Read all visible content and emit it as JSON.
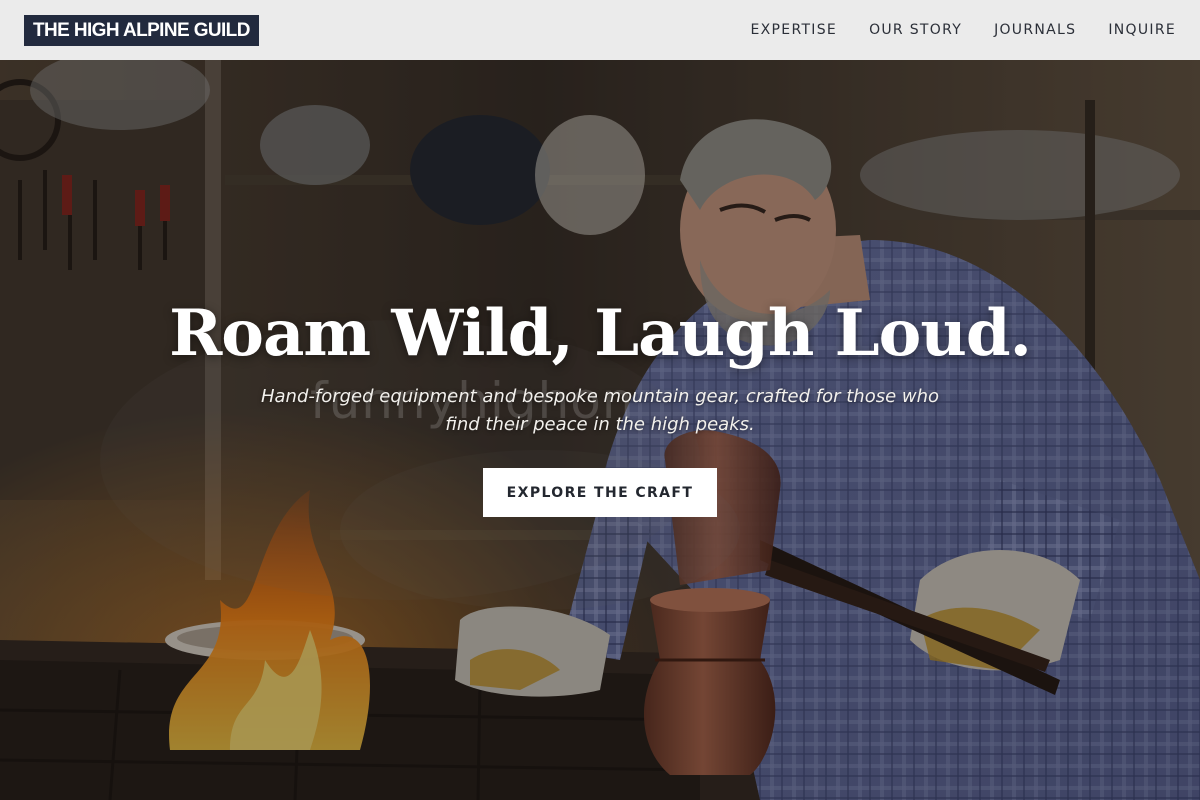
{
  "header": {
    "logo_text": "THE HIGH ALPINE GUILD",
    "nav": [
      {
        "label": "EXPERTISE"
      },
      {
        "label": "OUR STORY"
      },
      {
        "label": "JOURNALS"
      },
      {
        "label": "INQUIRE"
      }
    ]
  },
  "hero": {
    "title": "Roam Wild, Laugh Loud.",
    "watermark": "funnyhighon",
    "subtitle": "Hand-forged equipment and bespoke mountain gear, crafted for those who find their peace in the high peaks.",
    "cta_label": "EXPLORE THE CRAFT",
    "background_image": "artisan-workshop-photo"
  },
  "colors": {
    "header_bg": "#ebebeb",
    "logo_bg": "#222a3e",
    "nav_text": "#2b2f38",
    "cta_bg": "#ffffff",
    "cta_text": "#23272f"
  }
}
